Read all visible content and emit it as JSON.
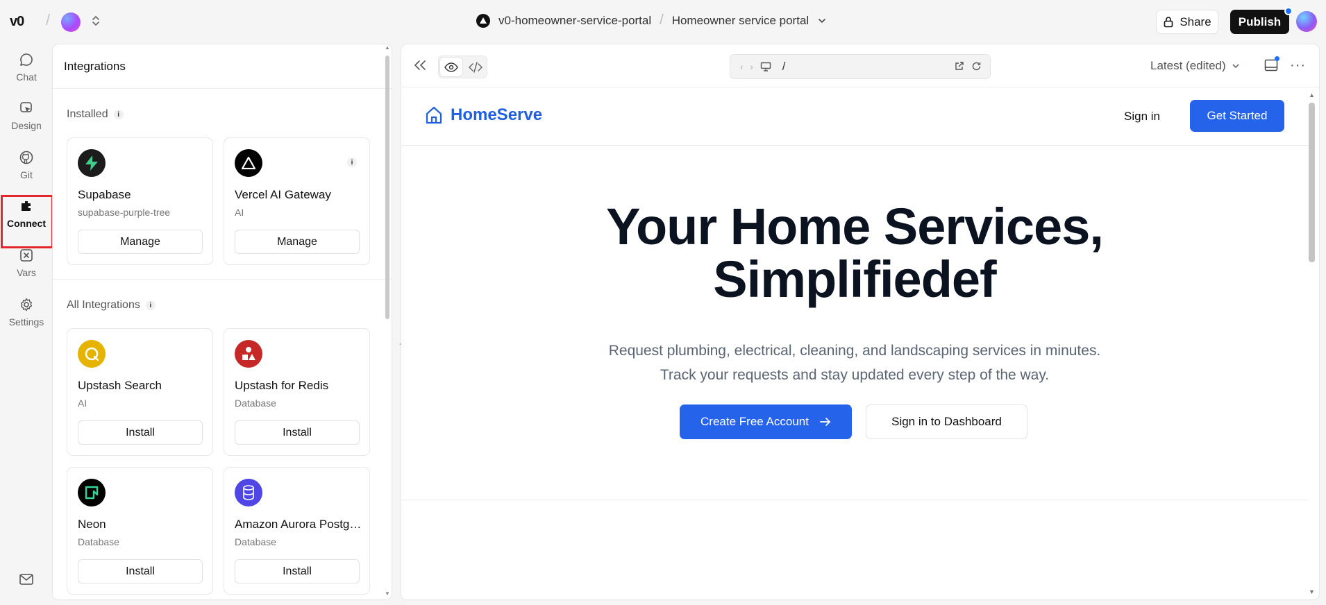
{
  "topbar": {
    "logo": "v0",
    "project_name": "v0-homeowner-service-portal",
    "chat_name": "Homeowner service portal",
    "share_label": "Share",
    "publish_label": "Publish"
  },
  "rail": {
    "items": [
      {
        "label": "Chat",
        "icon": "chat-bubble-icon"
      },
      {
        "label": "Design",
        "icon": "design-cursor-icon"
      },
      {
        "label": "Git",
        "icon": "github-icon"
      },
      {
        "label": "Connect",
        "icon": "plug-icon",
        "active": true
      },
      {
        "label": "Vars",
        "icon": "variable-icon"
      },
      {
        "label": "Settings",
        "icon": "gear-icon"
      }
    ]
  },
  "integrations": {
    "title": "Integrations",
    "installed_label": "Installed",
    "all_label": "All Integrations",
    "installed": [
      {
        "name": "Supabase",
        "sub": "supabase-purple-tree",
        "action": "Manage"
      },
      {
        "name": "Vercel AI Gateway",
        "sub": "AI",
        "action": "Manage"
      }
    ],
    "all": [
      {
        "name": "Upstash Search",
        "sub": "AI",
        "action": "Install"
      },
      {
        "name": "Upstash for Redis",
        "sub": "Database",
        "action": "Install"
      },
      {
        "name": "Neon",
        "sub": "Database",
        "action": "Install"
      },
      {
        "name": "Amazon Aurora Postgres",
        "sub": "Database",
        "action": "Install"
      }
    ]
  },
  "preview_toolbar": {
    "url_path": "/",
    "version_label": "Latest (edited)"
  },
  "site": {
    "brand": "HomeServe",
    "signin": "Sign in",
    "get_started": "Get Started",
    "hero_line1": "Your Home Services,",
    "hero_line2": "Simplifiedef",
    "sub_line1": "Request plumbing, electrical, cleaning, and landscaping services in minutes.",
    "sub_line2": "Track your requests and stay updated every step of the way.",
    "cta_primary": "Create Free Account",
    "cta_secondary": "Sign in to Dashboard"
  },
  "colors": {
    "accent_blue": "#2563eb",
    "brand_blue": "#1f5fe0",
    "highlight_red": "#e3262c"
  }
}
